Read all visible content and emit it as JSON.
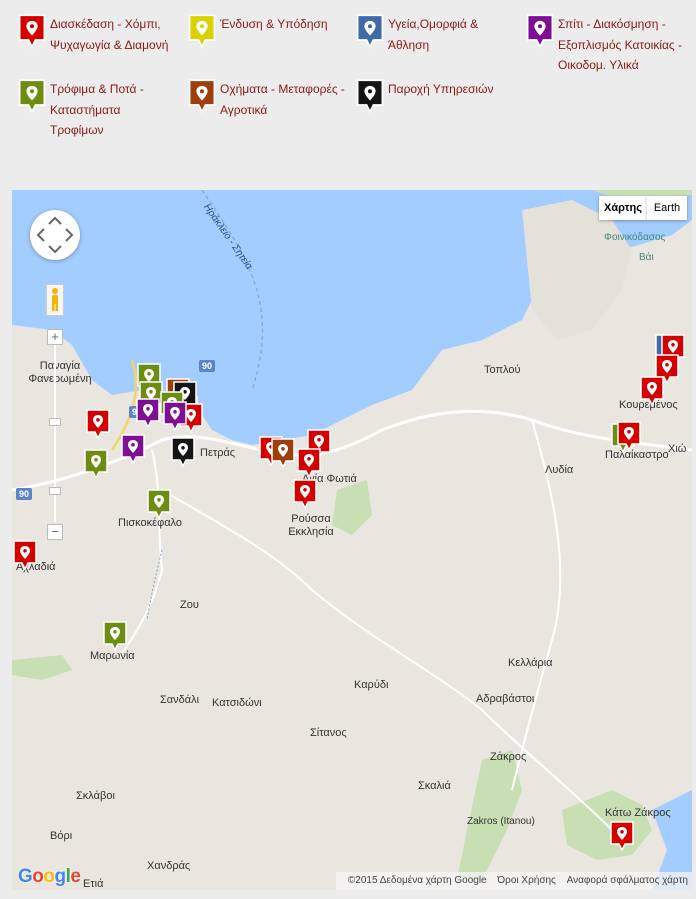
{
  "colors": {
    "red": "#d40000",
    "yellow": "#dbd100",
    "blue": "#3f6aa8",
    "purple": "#7e0f95",
    "green": "#6d8d11",
    "brown": "#9c3f0b",
    "black": "#141414",
    "legend_text": "#8b1a10",
    "sea": "#a3ccff",
    "land": "#e9e6df"
  },
  "legend": [
    {
      "label": "Διασκέδαση - Χόμπι, Ψυχαγωγία & Διαμονή",
      "color": "red"
    },
    {
      "label": "Ένδυση & Υπόδηση",
      "color": "yellow"
    },
    {
      "label": "Υγεία,Ομορφιά & Άθληση",
      "color": "blue"
    },
    {
      "label": "Σπίτι - Διακόσμηση - Εξοπλισμός Κατοικίας - Οικοδομ. Υλικά",
      "color": "purple"
    },
    {
      "label": "Τρόφιμα & Ποτά - Καταστήματα Τροφίμων",
      "color": "green"
    },
    {
      "label": "Οχήματα - Μεταφορές - Αγροτικά",
      "color": "brown"
    },
    {
      "label": "Παροχή Υπηρεσιών",
      "color": "black"
    }
  ],
  "map": {
    "map_type_buttons": [
      "Χάρτης",
      "Earth"
    ],
    "selected_map_type": "Χάρτης",
    "zoom_in": "+",
    "zoom_out": "−",
    "places": [
      "Φοινικόδασος",
      "Βάι",
      "Τοπλού",
      "Κουρεμένος",
      "Χιώ",
      "Λυδία",
      "Παλαίκαστρο",
      "Παναγία Φανερωμένη",
      "Πετράς",
      "Πισκοκέφαλο",
      "Ρούσσα Εκκλησία",
      "Αγία Φωτιά",
      "Αχλαδιά",
      "Ζου",
      "Μαρωνία",
      "Σανδάλι",
      "Κατσιδώνι",
      "Καρύδι",
      "Σίτανος",
      "Κελλάρια",
      "Αδραβάστοι",
      "Ζάκρος",
      "Σκαλιά",
      "Zakros (Itanou)",
      "Κάτω Ζάκρος",
      "Σκλάβοι",
      "Βόρι",
      "Χανδράς",
      "Ετιά"
    ],
    "road_label": "Ηράκλειο - Σητεία",
    "road_numbers": [
      "90",
      "90",
      "90"
    ],
    "footer": {
      "copyright": "©2015 Δεδομένα χάρτη Google",
      "terms": "Όροι Χρήσης",
      "report": "Αναφορά σφάλματος χάρτη"
    },
    "logo": "Google",
    "markers": [
      {
        "color": "blue"
      },
      {
        "color": "red"
      },
      {
        "color": "red"
      },
      {
        "color": "red"
      },
      {
        "color": "green"
      },
      {
        "color": "red"
      },
      {
        "color": "green"
      },
      {
        "color": "green"
      },
      {
        "color": "purple"
      },
      {
        "color": "brown"
      },
      {
        "color": "brown"
      },
      {
        "color": "black"
      },
      {
        "color": "red"
      },
      {
        "color": "green"
      },
      {
        "color": "purple"
      },
      {
        "color": "red"
      },
      {
        "color": "black"
      },
      {
        "color": "purple"
      },
      {
        "color": "green"
      },
      {
        "color": "green"
      },
      {
        "color": "red"
      },
      {
        "color": "red"
      },
      {
        "color": "brown"
      },
      {
        "color": "red"
      },
      {
        "color": "red"
      },
      {
        "color": "red"
      },
      {
        "color": "green"
      },
      {
        "color": "red"
      }
    ]
  }
}
